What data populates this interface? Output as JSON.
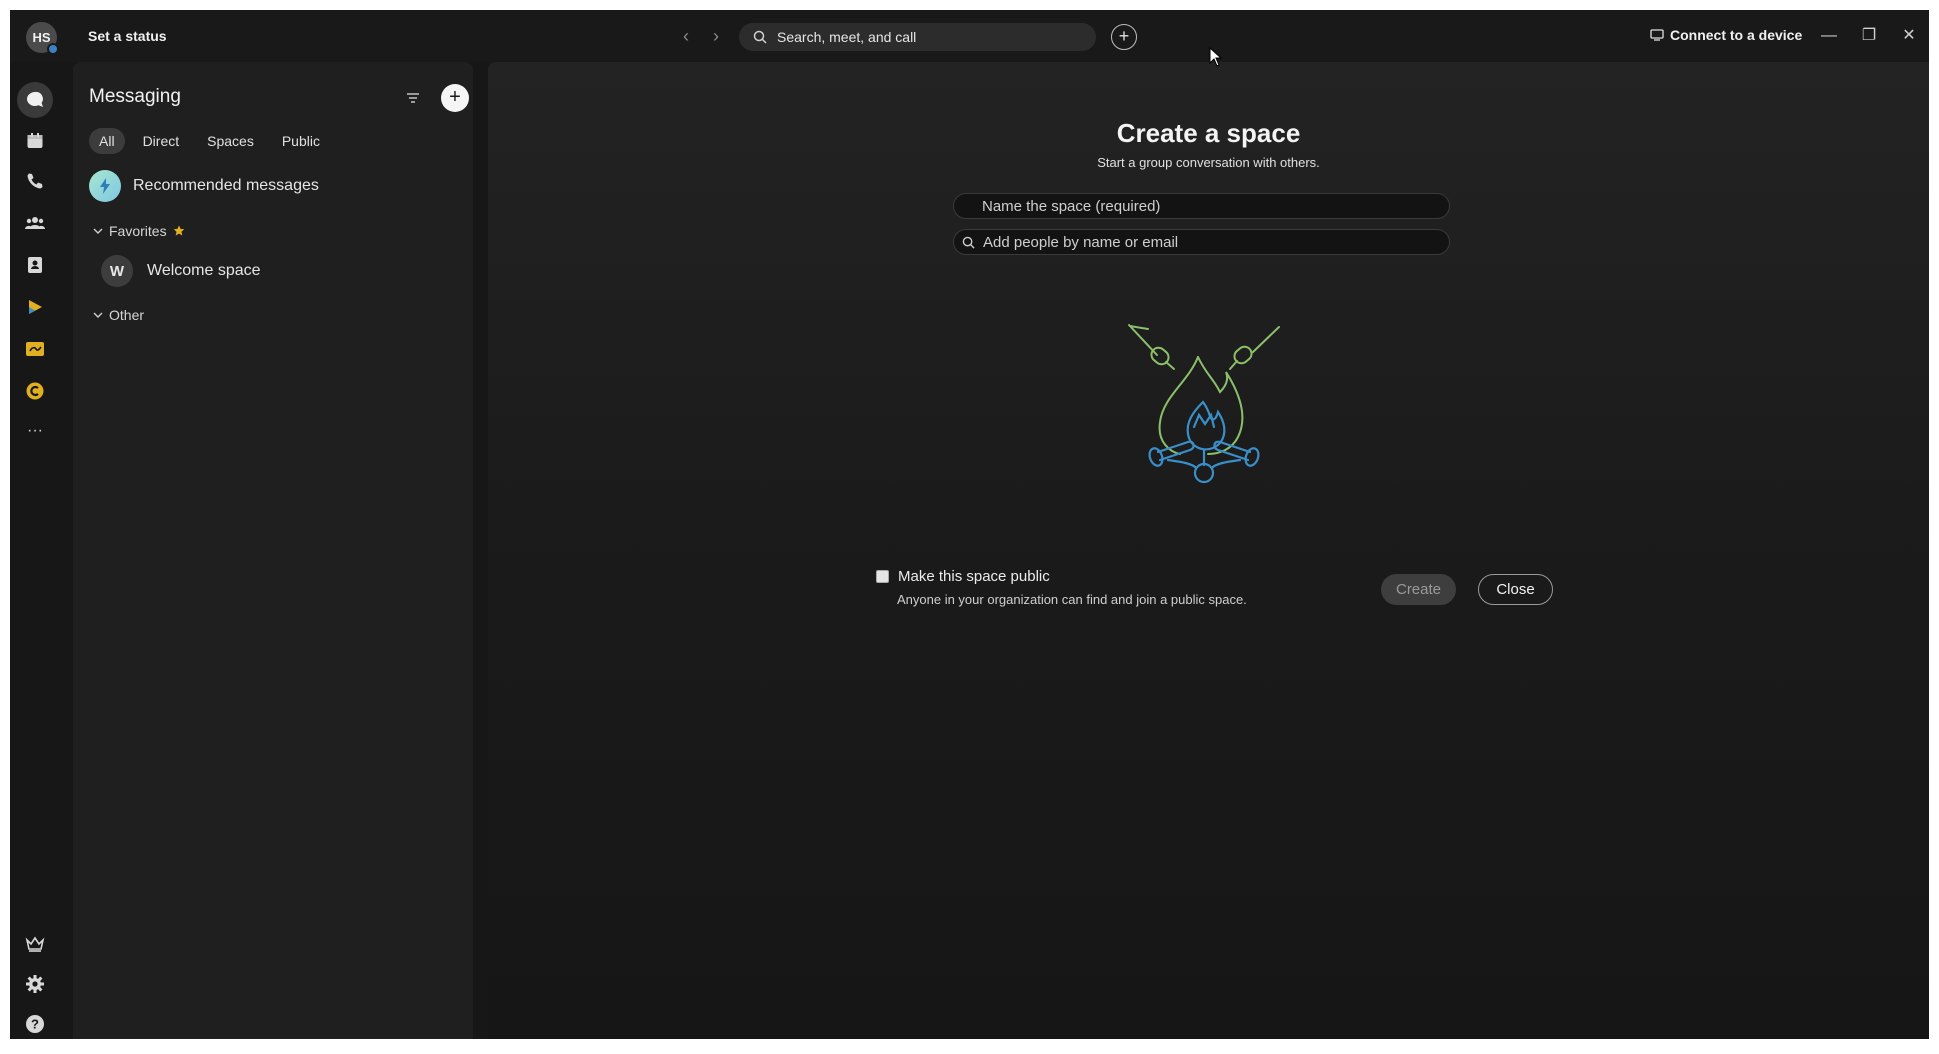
{
  "titlebar": {
    "avatar_initials": "HS",
    "set_status": "Set a status",
    "search_placeholder": "Search, meet, and call",
    "connect_label": "Connect to a device"
  },
  "rail": {
    "items": [
      "messaging-icon",
      "calendar-icon",
      "calls-icon",
      "teams-icon",
      "contacts-icon",
      "apps-icon",
      "vidcast-icon",
      "slido-icon",
      "more-icon"
    ],
    "bottom_items": [
      "upgrade-icon",
      "settings-icon",
      "help-icon"
    ],
    "more_label": "···"
  },
  "messaging": {
    "title": "Messaging",
    "tabs": [
      {
        "label": "All",
        "active": true
      },
      {
        "label": "Direct"
      },
      {
        "label": "Spaces"
      },
      {
        "label": "Public"
      }
    ],
    "recommended_label": "Recommended messages",
    "favorites_label": "Favorites",
    "favorites_items": [
      {
        "initial": "W",
        "label": "Welcome space"
      }
    ],
    "other_label": "Other"
  },
  "create_space": {
    "title": "Create a space",
    "subtitle": "Start a group conversation with others.",
    "name_placeholder": "Name the space (required)",
    "people_placeholder": "Add people by name or email",
    "public_label": "Make this space public",
    "public_desc": "Anyone in your organization can find and join a public space.",
    "create_button": "Create",
    "close_button": "Close"
  },
  "colors": {
    "background": "#171717",
    "panel": "#1f1f1f",
    "accent_green": "#8bc06a",
    "accent_blue": "#3a8fc9",
    "rail_icon_yellow": "#e0b020"
  }
}
